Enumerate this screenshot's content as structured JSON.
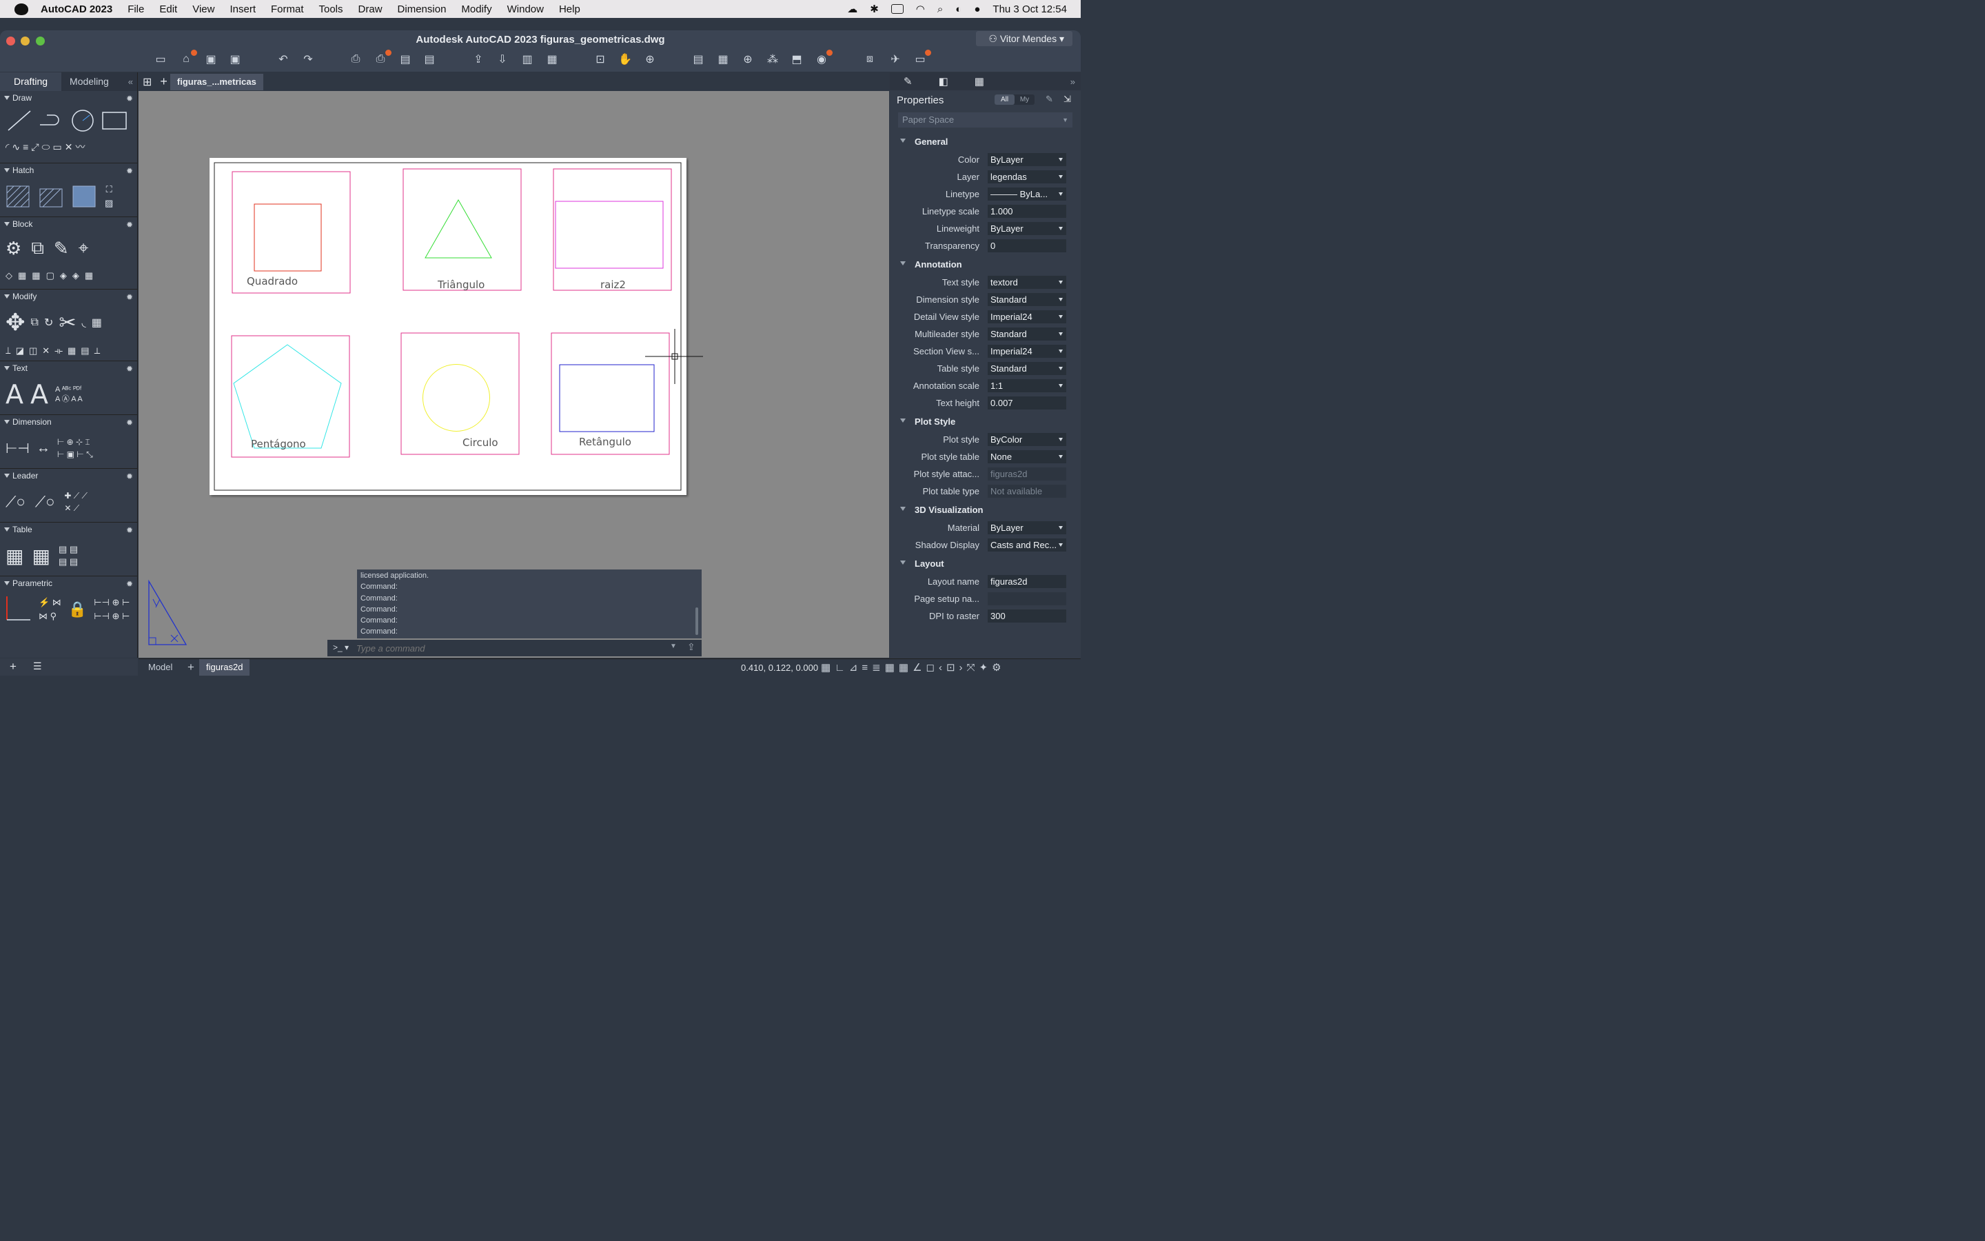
{
  "menubar": {
    "app_name": "AutoCAD 2023",
    "items": [
      "File",
      "Edit",
      "View",
      "Insert",
      "Format",
      "Tools",
      "Draw",
      "Dimension",
      "Modify",
      "Window",
      "Help"
    ],
    "clock": "Thu 3 Oct  12:54"
  },
  "window": {
    "title": "Autodesk AutoCAD 2023    figuras_geometricas.dwg",
    "user": "Vitor Mendes"
  },
  "left_tabs": {
    "drafting": "Drafting",
    "modeling": "Modeling"
  },
  "palette_sections": [
    "Draw",
    "Hatch",
    "Block",
    "Modify",
    "Text",
    "Dimension",
    "Leader",
    "Table",
    "Parametric"
  ],
  "doc_tab": "figuras_...metricas",
  "drawing": {
    "labels": {
      "quadrado": "Quadrado",
      "triangulo": "Triângulo",
      "raiz2": "raiz2",
      "pentagono": "Pentágono",
      "circulo": "Circulo",
      "retangulo": "Retângulo"
    },
    "colors": {
      "frame": "#e0308a",
      "square": "#e0301e",
      "triangle": "#33dd33",
      "raiz2": "#dd33dd",
      "pentagon": "#33e6e6",
      "circle": "#f0f030",
      "rectangle": "#2222cc"
    }
  },
  "properties": {
    "title": "Properties",
    "filter_all": "All",
    "filter_my": "My",
    "selection": "Paper Space",
    "groups": [
      {
        "name": "General",
        "rows": [
          {
            "k": "Color",
            "v": "ByLayer",
            "type": "dd"
          },
          {
            "k": "Layer",
            "v": "legendas",
            "type": "dd"
          },
          {
            "k": "Linetype",
            "v": "——— ByLa...",
            "type": "dd"
          },
          {
            "k": "Linetype scale",
            "v": "1.000",
            "type": "text"
          },
          {
            "k": "Lineweight",
            "v": "ByLayer",
            "type": "dd"
          },
          {
            "k": "Transparency",
            "v": "0",
            "type": "text"
          }
        ]
      },
      {
        "name": "Annotation",
        "rows": [
          {
            "k": "Text style",
            "v": "textord",
            "type": "dd"
          },
          {
            "k": "Dimension style",
            "v": "Standard",
            "type": "dd"
          },
          {
            "k": "Detail View style",
            "v": "Imperial24",
            "type": "dd"
          },
          {
            "k": "Multileader style",
            "v": "Standard",
            "type": "dd"
          },
          {
            "k": "Section View s...",
            "v": "Imperial24",
            "type": "dd"
          },
          {
            "k": "Table style",
            "v": "Standard",
            "type": "dd"
          },
          {
            "k": "Annotation scale",
            "v": "1:1",
            "type": "dd"
          },
          {
            "k": "Text height",
            "v": "0.007",
            "type": "text"
          }
        ]
      },
      {
        "name": "Plot Style",
        "rows": [
          {
            "k": "Plot style",
            "v": "ByColor",
            "type": "dd"
          },
          {
            "k": "Plot style table",
            "v": "None",
            "type": "dd"
          },
          {
            "k": "Plot style attac...",
            "v": "figuras2d",
            "type": "dis"
          },
          {
            "k": "Plot table type",
            "v": "Not available",
            "type": "dis"
          }
        ]
      },
      {
        "name": "3D Visualization",
        "rows": [
          {
            "k": "Material",
            "v": "ByLayer",
            "type": "dd"
          },
          {
            "k": "Shadow Display",
            "v": "Casts and Rec...",
            "type": "dd"
          }
        ]
      },
      {
        "name": "Layout",
        "rows": [
          {
            "k": "Layout name",
            "v": "figuras2d",
            "type": "text"
          },
          {
            "k": "Page setup na...",
            "v": "",
            "type": "dis"
          },
          {
            "k": "DPI to raster",
            "v": "300",
            "type": "text"
          }
        ]
      }
    ]
  },
  "command": {
    "history": [
      "licensed application.",
      "Command:",
      "Command:",
      "Command:",
      "Command:",
      "Command:"
    ],
    "placeholder": "Type a command",
    "prompt": ">_"
  },
  "status": {
    "model_tab": "Model",
    "layout_tab": "figuras2d",
    "coords": "0.410, 0.122, 0.000"
  }
}
